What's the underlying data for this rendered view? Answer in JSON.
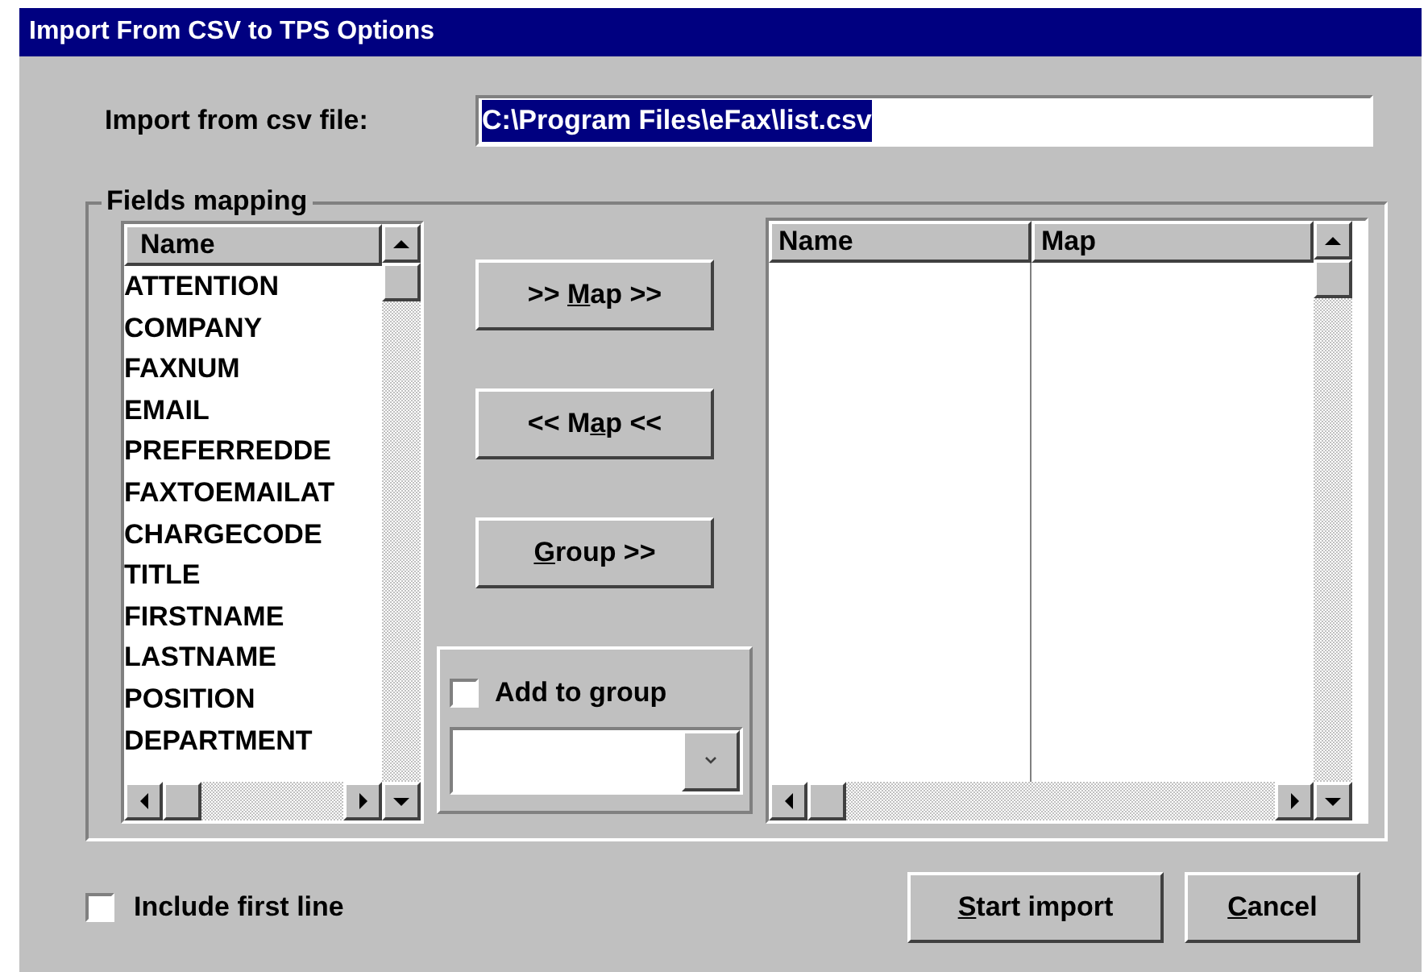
{
  "window": {
    "title": "Import From CSV to TPS Options"
  },
  "import_file": {
    "label": "Import from csv file:",
    "value": "C:\\Program Files\\eFax\\list.csv",
    "text_selected": true
  },
  "fields_mapping": {
    "legend": "Fields mapping",
    "source_list": {
      "columns": [
        "Name"
      ],
      "items": [
        "ATTENTION",
        "COMPANY",
        "FAXNUM",
        "EMAIL",
        "PREFERREDDE",
        "FAXTOEMAILAT",
        "CHARGECODE",
        "TITLE",
        "FIRSTNAME",
        "LASTNAME",
        "POSITION",
        "DEPARTMENT"
      ]
    },
    "buttons": [
      {
        "before": ">> ",
        "key": "M",
        "after": "ap >>"
      },
      {
        "before": "<< M",
        "key": "a",
        "after": "p <<"
      },
      {
        "key": "G",
        "after": "roup >>"
      }
    ],
    "add_to_group": {
      "label": "Add to group",
      "checked": false
    },
    "mapping_table": {
      "columns": [
        "Name",
        "Map"
      ]
    }
  },
  "include_first_line": {
    "label": "Include first line",
    "checked": false
  },
  "actions": [
    {
      "key": "S",
      "after": "tart import"
    },
    {
      "key": "C",
      "after": "ancel"
    }
  ]
}
